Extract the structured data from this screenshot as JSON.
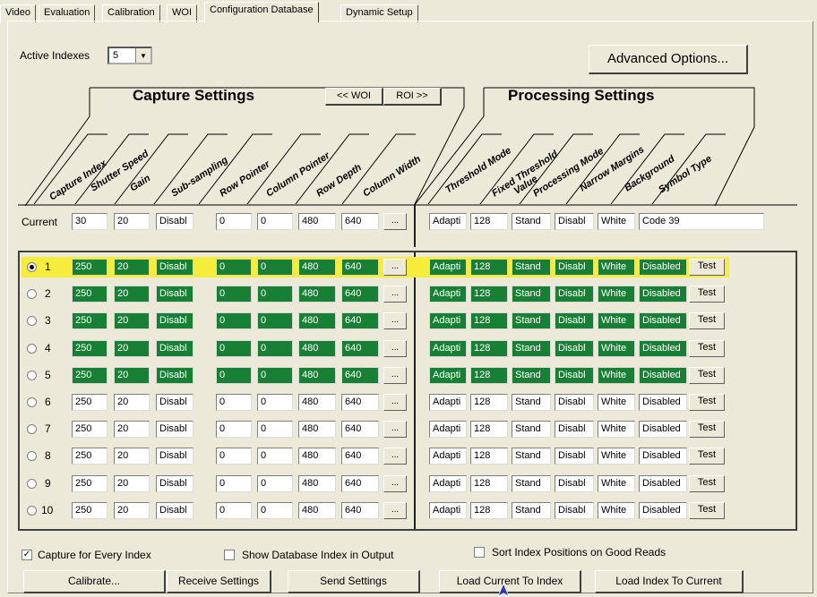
{
  "tabs": [
    "Video",
    "Evaluation",
    "Calibration",
    "WOI",
    "Configuration Database",
    "Dynamic Setup"
  ],
  "active_indexes": {
    "label": "Active Indexes",
    "value": "5"
  },
  "advanced_options_label": "Advanced Options...",
  "capture": {
    "title": "Capture Settings",
    "woi_button": "<< WOI",
    "roi_button": "ROI >>",
    "columns": [
      "Capture Index",
      "Shutter Speed",
      "Gain",
      "Sub-sampling",
      "Row Pointer",
      "Column Pointer",
      "Row Depth",
      "Column Width"
    ]
  },
  "processing": {
    "title": "Processing Settings",
    "columns": [
      "Threshold Mode",
      "Fixed Threshold\nValue",
      "Processing Mode",
      "Narrow Margins",
      "Background",
      "Symbol Type"
    ]
  },
  "current_row": {
    "label": "Current",
    "capture": [
      "30",
      "20",
      "Disabl",
      "0",
      "0",
      "480",
      "640"
    ],
    "processing": [
      "Adapti",
      "128",
      "Stand",
      "Disabl",
      "White",
      "Code 39"
    ]
  },
  "rows": [
    {
      "index": "1",
      "selected": true,
      "active": true,
      "capture": [
        "250",
        "20",
        "Disabl",
        "0",
        "0",
        "480",
        "640"
      ],
      "processing": [
        "Adapti",
        "128",
        "Stand",
        "Disabl",
        "White",
        "Disabled"
      ],
      "test": "Test"
    },
    {
      "index": "2",
      "selected": false,
      "active": true,
      "capture": [
        "250",
        "20",
        "Disabl",
        "0",
        "0",
        "480",
        "640"
      ],
      "processing": [
        "Adapti",
        "128",
        "Stand",
        "Disabl",
        "White",
        "Disabled"
      ],
      "test": "Test"
    },
    {
      "index": "3",
      "selected": false,
      "active": true,
      "capture": [
        "250",
        "20",
        "Disabl",
        "0",
        "0",
        "480",
        "640"
      ],
      "processing": [
        "Adapti",
        "128",
        "Stand",
        "Disabl",
        "White",
        "Disabled"
      ],
      "test": "Test"
    },
    {
      "index": "4",
      "selected": false,
      "active": true,
      "capture": [
        "250",
        "20",
        "Disabl",
        "0",
        "0",
        "480",
        "640"
      ],
      "processing": [
        "Adapti",
        "128",
        "Stand",
        "Disabl",
        "White",
        "Disabled"
      ],
      "test": "Test"
    },
    {
      "index": "5",
      "selected": false,
      "active": true,
      "capture": [
        "250",
        "20",
        "Disabl",
        "0",
        "0",
        "480",
        "640"
      ],
      "processing": [
        "Adapti",
        "128",
        "Stand",
        "Disabl",
        "White",
        "Disabled"
      ],
      "test": "Test"
    },
    {
      "index": "6",
      "selected": false,
      "active": false,
      "capture": [
        "250",
        "20",
        "Disabl",
        "0",
        "0",
        "480",
        "640"
      ],
      "processing": [
        "Adapti",
        "128",
        "Stand",
        "Disabl",
        "White",
        "Disabled"
      ],
      "test": "Test"
    },
    {
      "index": "7",
      "selected": false,
      "active": false,
      "capture": [
        "250",
        "20",
        "Disabl",
        "0",
        "0",
        "480",
        "640"
      ],
      "processing": [
        "Adapti",
        "128",
        "Stand",
        "Disabl",
        "White",
        "Disabled"
      ],
      "test": "Test"
    },
    {
      "index": "8",
      "selected": false,
      "active": false,
      "capture": [
        "250",
        "20",
        "Disabl",
        "0",
        "0",
        "480",
        "640"
      ],
      "processing": [
        "Adapti",
        "128",
        "Stand",
        "Disabl",
        "White",
        "Disabled"
      ],
      "test": "Test"
    },
    {
      "index": "9",
      "selected": false,
      "active": false,
      "capture": [
        "250",
        "20",
        "Disabl",
        "0",
        "0",
        "480",
        "640"
      ],
      "processing": [
        "Adapti",
        "128",
        "Stand",
        "Disabl",
        "White",
        "Disabled"
      ],
      "test": "Test"
    },
    {
      "index": "10",
      "selected": false,
      "active": false,
      "capture": [
        "250",
        "20",
        "Disabl",
        "0",
        "0",
        "480",
        "640"
      ],
      "processing": [
        "Adapti",
        "128",
        "Stand",
        "Disabl",
        "White",
        "Disabled"
      ],
      "test": "Test"
    }
  ],
  "ellipsis_label": "...",
  "options": {
    "capture_every_index": {
      "label": "Capture for Every Index",
      "checked": true
    },
    "show_db_index": {
      "label": "Show Database Index in Output",
      "checked": false
    },
    "sort_index": {
      "label": "Sort Index Positions on Good Reads",
      "checked": false
    }
  },
  "buttons": {
    "calibrate": "Calibrate...",
    "receive": "Receive Settings",
    "send": "Send Settings",
    "load_current_to_index": "Load Current To Index",
    "load_index_to_current": "Load Index To Current"
  },
  "colors": {
    "active_cell": "#178035",
    "selected_row": "#f5ec3c",
    "panel": "#ece9d8"
  }
}
